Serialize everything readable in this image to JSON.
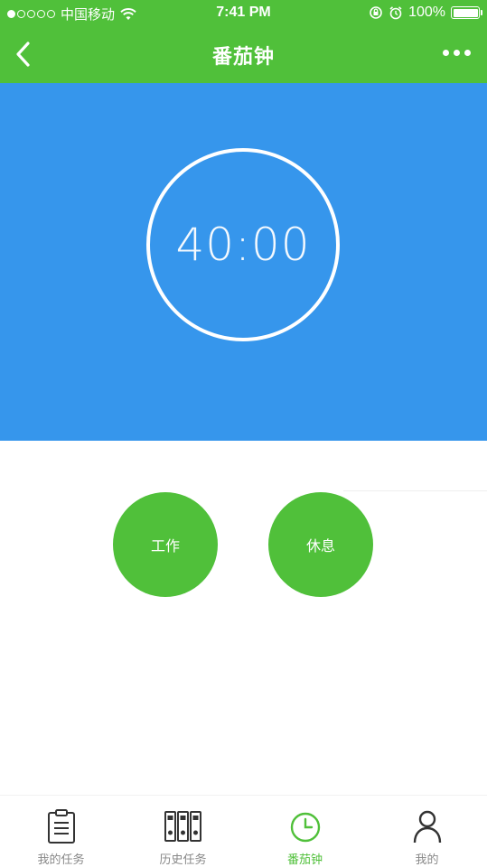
{
  "status_bar": {
    "carrier": "中国移动",
    "time": "7:41 PM",
    "battery": "100%"
  },
  "nav": {
    "title": "番茄钟"
  },
  "timer": {
    "display": "40:00"
  },
  "actions": {
    "work_label": "工作",
    "rest_label": "休息"
  },
  "tabs": [
    {
      "label": "我的任务",
      "icon": "clipboard-icon"
    },
    {
      "label": "历史任务",
      "icon": "binders-icon"
    },
    {
      "label": "番茄钟",
      "icon": "clock-icon"
    },
    {
      "label": "我的",
      "icon": "person-icon"
    }
  ],
  "colors": {
    "brand_green": "#50c03a",
    "timer_blue": "#3696ec"
  }
}
